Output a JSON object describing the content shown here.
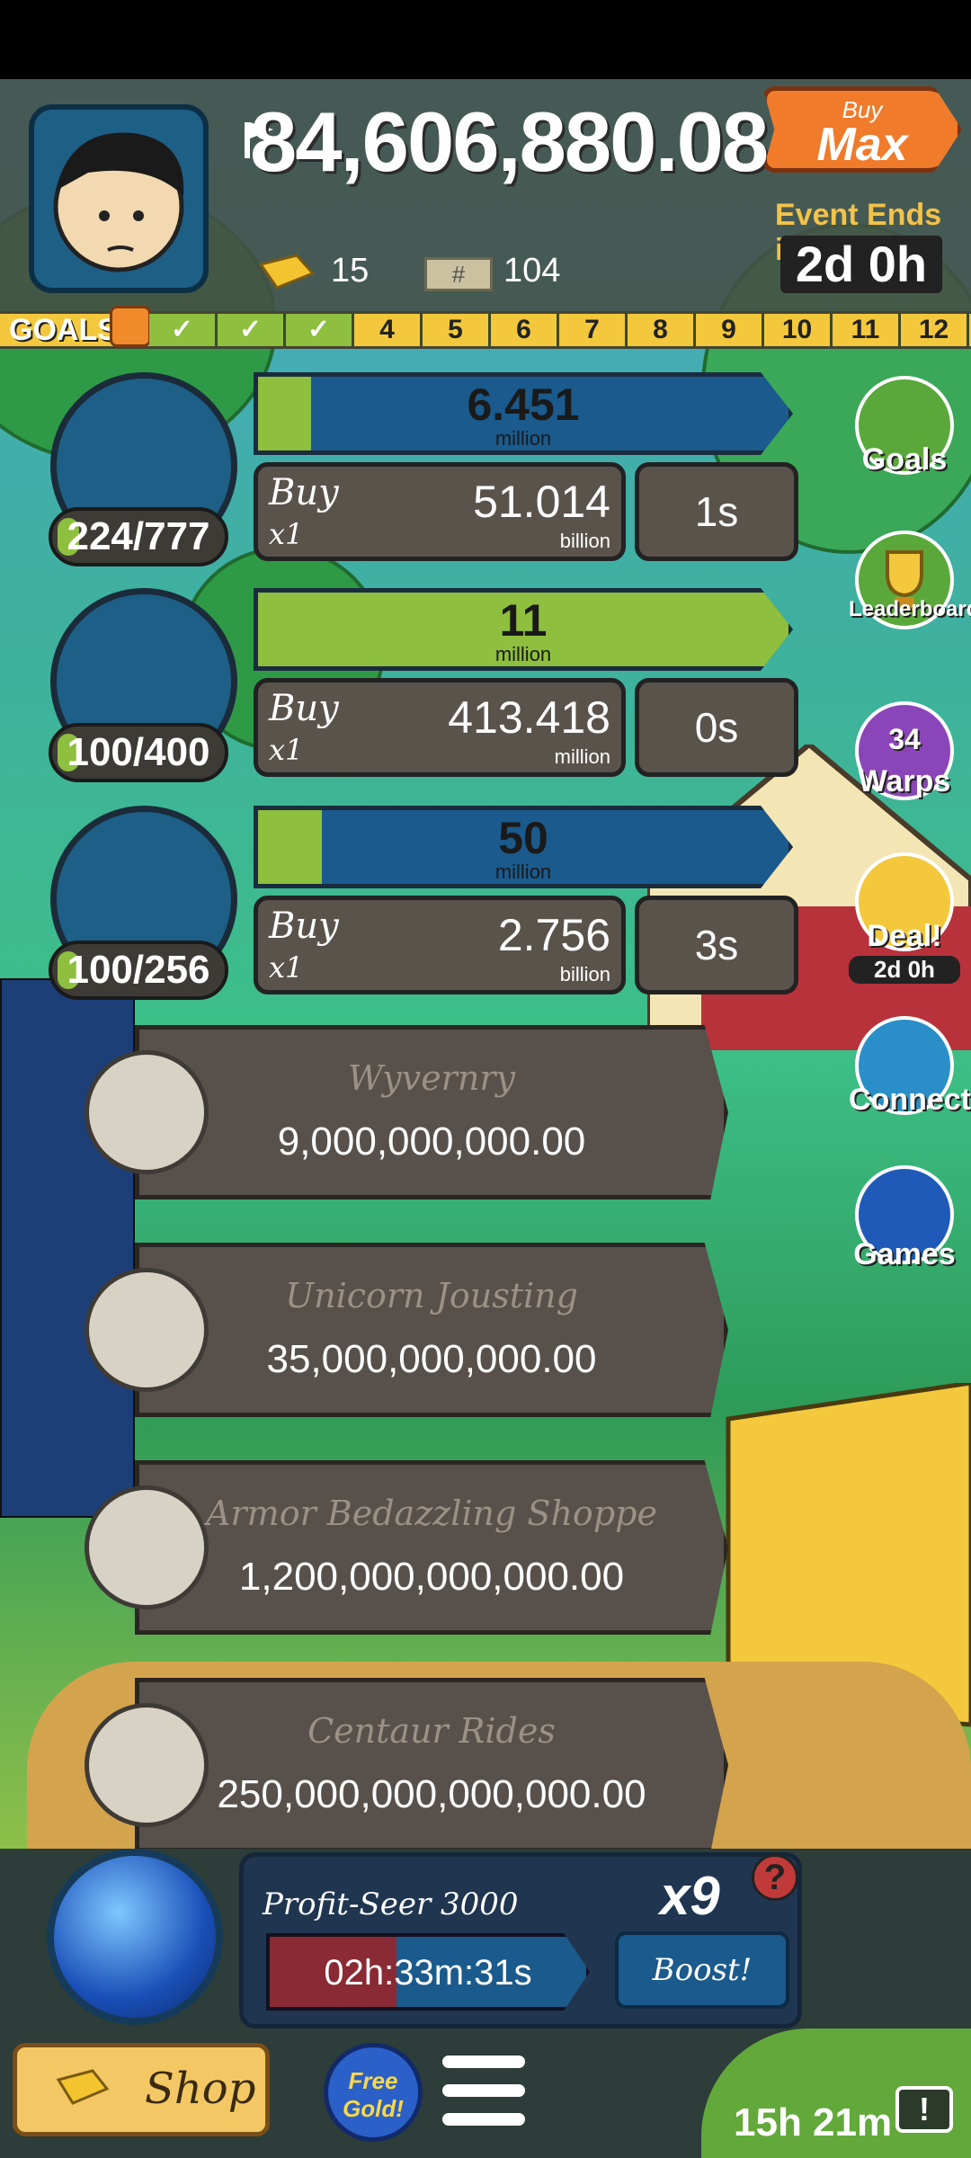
{
  "header": {
    "cash": "84,606,880.08",
    "buy_max_small": "Buy",
    "buy_max_big": "Max",
    "event_label": "Event Ends in:",
    "event_time": "2d 0h",
    "gold_count": "15",
    "megabucks_count": "104"
  },
  "goals_bar": {
    "label": "GOALS",
    "completed": [
      "✓",
      "✓",
      "✓"
    ],
    "numbers": [
      "4",
      "5",
      "6",
      "7",
      "8",
      "9",
      "10",
      "11",
      "12"
    ]
  },
  "businesses": [
    {
      "count": "224/777",
      "progress_value": "6.451",
      "progress_unit": "million",
      "progress_fill": 0.1,
      "buy_label": "Buy",
      "buy_mult": "x1",
      "cost": "51.014",
      "cost_unit": "billion",
      "time": "1s"
    },
    {
      "count": "100/400",
      "progress_value": "11",
      "progress_unit": "million",
      "progress_fill": 1.0,
      "buy_label": "Buy",
      "buy_mult": "x1",
      "cost": "413.418",
      "cost_unit": "million",
      "time": "0s"
    },
    {
      "count": "100/256",
      "progress_value": "50",
      "progress_unit": "million",
      "progress_fill": 0.12,
      "buy_label": "Buy",
      "buy_mult": "x1",
      "cost": "2.756",
      "cost_unit": "billion",
      "time": "3s"
    }
  ],
  "locked": [
    {
      "name": "Wyvernry",
      "price": "9,000,000,000.00"
    },
    {
      "name": "Unicorn Jousting",
      "price": "35,000,000,000.00"
    },
    {
      "name": "Armor Bedazzling Shoppe",
      "price": "1,200,000,000,000.00"
    },
    {
      "name": "Centaur Rides",
      "price": "250,000,000,000,000.00"
    }
  ],
  "side": {
    "goals": "Goals",
    "leaderboard": "Leaderboard",
    "warps_count": "34",
    "warps": "Warps",
    "deal": "Deal!",
    "deal_time": "2d 0h",
    "connect": "Connect",
    "games": "Games"
  },
  "manager": {
    "name": "Profit-Seer 3000",
    "multiplier": "x9",
    "help": "?",
    "timer": "02h:33m:31s",
    "boost": "Boost!"
  },
  "bottom": {
    "shop": "Shop",
    "free_gold_1": "Free",
    "free_gold_2": "Gold!",
    "tv_time": "15h 21m",
    "tv_icon": "!"
  },
  "colors": {
    "accent_green": "#8ebf3e",
    "progress_blue": "#1b5a8c",
    "buy_max_orange": "#f07b2b",
    "goals_yellow": "#f3c83c"
  }
}
